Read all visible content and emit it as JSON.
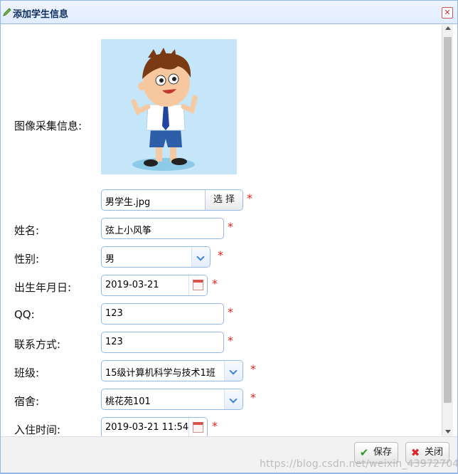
{
  "dialog": {
    "title": "添加学生信息",
    "title_icon": "pencil-icon",
    "close_icon": "close-icon"
  },
  "form": {
    "photo_label": "图像采集信息:",
    "photo_file": "男学生.jpg",
    "choose_button": "选 择",
    "name_label": "姓名:",
    "name_value": "弦上小风筝",
    "gender_label": "性别:",
    "gender_value": "男",
    "birth_label": "出生年月日:",
    "birth_value": "2019-03-21",
    "qq_label": "QQ:",
    "qq_value": "123",
    "contact_label": "联系方式:",
    "contact_value": "123",
    "class_label": "班级:",
    "class_value": "15级计算机科学与技术1班",
    "dorm_label": "宿舍:",
    "dorm_value": "桃花苑101",
    "checkin_label": "入住时间:",
    "checkin_value": "2019-03-21 11:54:",
    "required_mark": "*"
  },
  "footer": {
    "save_label": "保存",
    "close_label": "关闭",
    "save_icon": "checkmark-icon",
    "close_icon": "x-icon",
    "watermark": "https://blog.csdn.net/weixin_43972704"
  },
  "colors": {
    "border": "#95b8e7",
    "title_text": "#0e2d5f",
    "required": "#e02020",
    "photo_bg": "#c4e6f8"
  }
}
